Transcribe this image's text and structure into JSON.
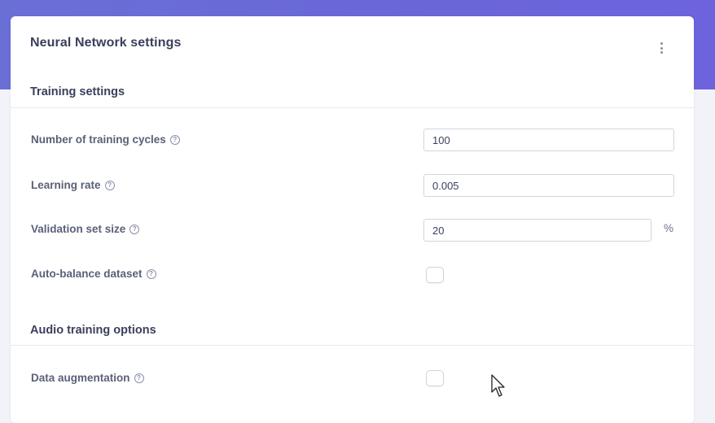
{
  "card": {
    "title": "Neural Network settings",
    "menu_icon": "kebab-menu-icon"
  },
  "training_settings": {
    "title": "Training settings",
    "fields": [
      {
        "label": "Number of training cycles",
        "value": "100",
        "help_icon": "question-circle-icon"
      },
      {
        "label": "Learning rate",
        "value": "0.005",
        "help_icon": "question-circle-icon"
      },
      {
        "label": "Validation set size",
        "value": "20",
        "unit": "%",
        "help_icon": "question-circle-icon"
      },
      {
        "label": "Auto-balance dataset",
        "checked": false,
        "help_icon": "question-circle-icon"
      }
    ]
  },
  "audio_training_options": {
    "title": "Audio training options",
    "fields": [
      {
        "label": "Data augmentation",
        "checked": false,
        "help_icon": "question-circle-icon"
      }
    ]
  },
  "colors": {
    "header_gradient": "#6a6fd6",
    "page_background": "#f2f3f9",
    "text_primary": "#3a3f5c",
    "text_label": "#5b6079"
  }
}
